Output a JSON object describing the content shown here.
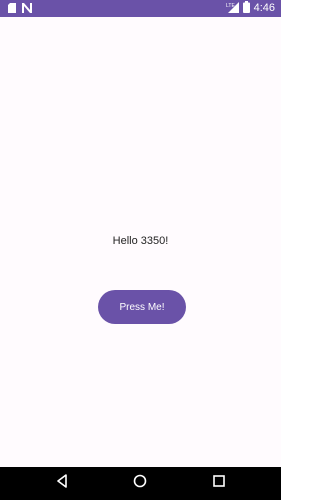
{
  "status_bar": {
    "time": "4:46",
    "left_icons": [
      "sd-card-icon",
      "network-n-icon"
    ],
    "right_icons": [
      "lte-signal-icon",
      "battery-icon"
    ]
  },
  "main": {
    "greeting": "Hello 3350!",
    "button_label": "Press Me!"
  },
  "nav_bar": {
    "buttons": [
      "back-icon",
      "home-icon",
      "recents-icon"
    ]
  },
  "colors": {
    "accent": "#6a52a8",
    "background": "#fffbfe",
    "nav_background": "#000000"
  }
}
